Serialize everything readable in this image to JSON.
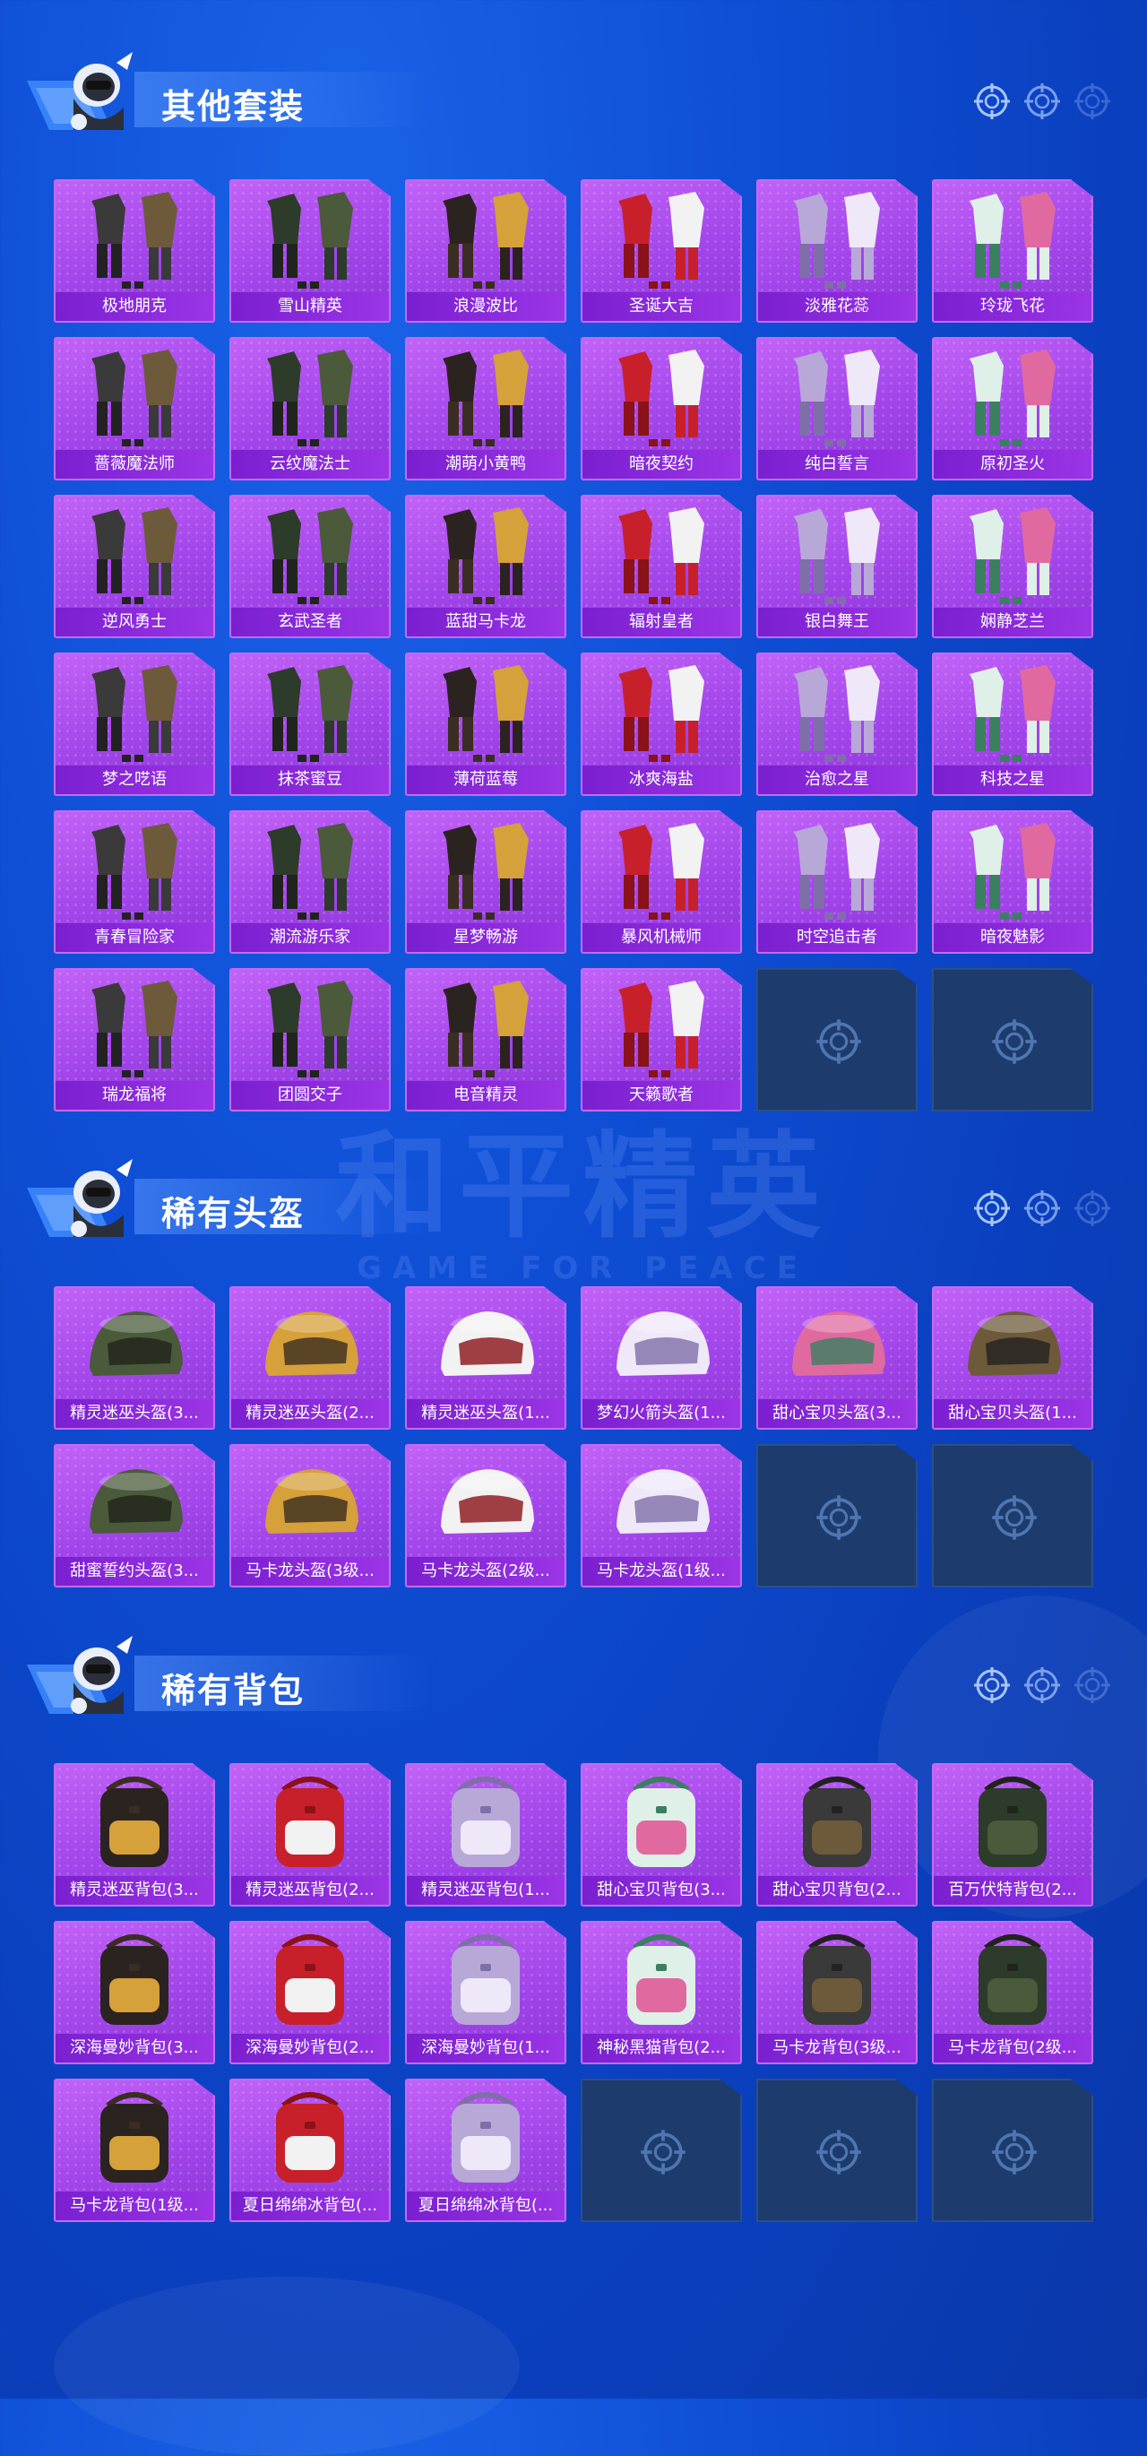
{
  "colors": {
    "background": "#0f4fd6",
    "card_purple": "#a245ea",
    "label_bar": "#7a1fd0",
    "card_border": "#c36bff",
    "empty_slot": "#1d3b6d"
  },
  "watermark": {
    "logo": "和平精英",
    "sub": "GAME FOR PEACE"
  },
  "sections": [
    {
      "title": "其他套装",
      "items": [
        "极地朋克",
        "雪山精英",
        "浪漫波比",
        "圣诞大吉",
        "淡雅花蕊",
        "玲珑飞花",
        "蔷薇魔法师",
        "云纹魔法士",
        "潮萌小黄鸭",
        "暗夜契约",
        "纯白誓言",
        "原初圣火",
        "逆风勇士",
        "玄武圣者",
        "蓝甜马卡龙",
        "辐射皇者",
        "银白舞王",
        "娴静芝兰",
        "梦之呓语",
        "抹茶蜜豆",
        "薄荷蓝莓",
        "冰爽海盐",
        "治愈之星",
        "科技之星",
        "青春冒险家",
        "潮流游乐家",
        "星梦畅游",
        "暴风机械师",
        "时空追击者",
        "暗夜魅影",
        "瑞龙福将",
        "团圆交子",
        "电音精灵",
        "天籁歌者"
      ],
      "empty_slots": 2
    },
    {
      "title": "稀有头盔",
      "items": [
        "精灵迷巫头盔(3...",
        "精灵迷巫头盔(2...",
        "精灵迷巫头盔(1...",
        "梦幻火箭头盔(1...",
        "甜心宝贝头盔(3...",
        "甜心宝贝头盔(1...",
        "甜蜜誓约头盔(3...",
        "马卡龙头盔(3级...",
        "马卡龙头盔(2级...",
        "马卡龙头盔(1级..."
      ],
      "empty_slots": 2
    },
    {
      "title": "稀有背包",
      "items": [
        "精灵迷巫背包(3...",
        "精灵迷巫背包(2...",
        "精灵迷巫背包(1...",
        "甜心宝贝背包(3...",
        "甜心宝贝背包(2...",
        "百万伏特背包(2...",
        "深海曼妙背包(3...",
        "深海曼妙背包(2...",
        "深海曼妙背包(1...",
        "神秘黑猫背包(2...",
        "马卡龙背包(3级...",
        "马卡龙背包(2级...",
        "马卡龙背包(1级...",
        "夏日绵绵冰背包(...",
        "夏日绵绵冰背包(..."
      ],
      "empty_slots": 3
    }
  ]
}
